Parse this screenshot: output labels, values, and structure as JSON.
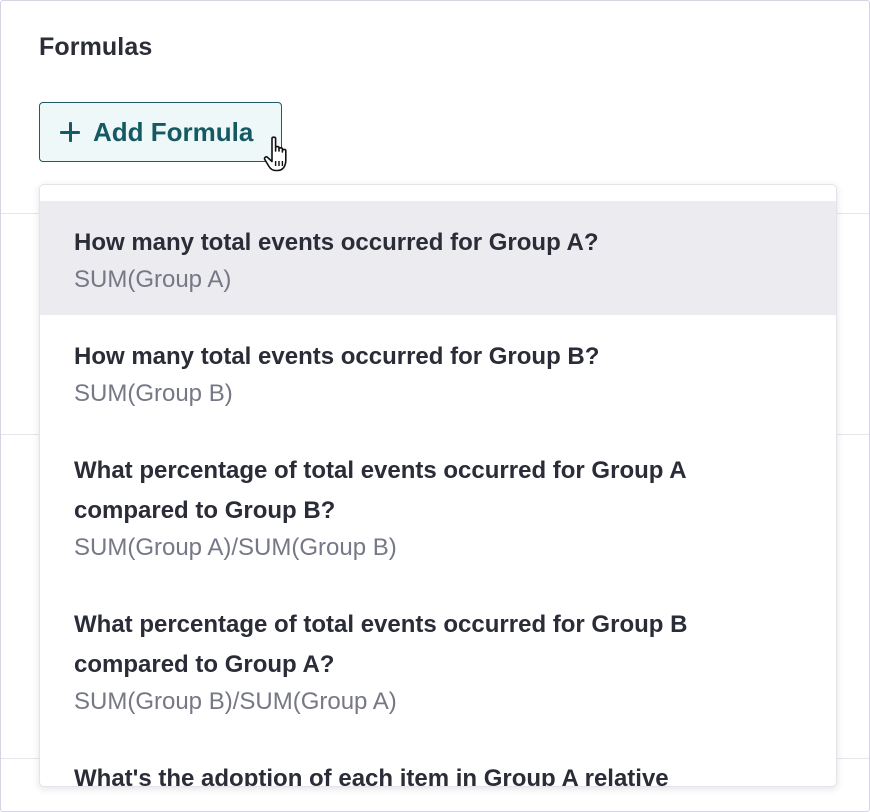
{
  "section": {
    "title": "Formulas"
  },
  "add_button": {
    "label": "Add Formula",
    "icon": "plus-icon"
  },
  "cursor": {
    "icon": "hand-pointer-icon"
  },
  "dropdown": {
    "options": [
      {
        "question": "How many total events occurred for Group A?",
        "formula": "SUM(Group A)",
        "highlighted": true
      },
      {
        "question": "How many total events occurred for Group B?",
        "formula": "SUM(Group B)",
        "highlighted": false
      },
      {
        "question": "What percentage of total events occurred for Group A compared to Group B?",
        "formula": "SUM(Group A)/SUM(Group B)",
        "highlighted": false
      },
      {
        "question": "What percentage of total events occurred for Group B compared to Group A?",
        "formula": "SUM(Group B)/SUM(Group A)",
        "highlighted": false
      },
      {
        "question": "What's the adoption of each item in Group A relative",
        "formula": "",
        "highlighted": false
      }
    ]
  },
  "colors": {
    "accent": "#155a62",
    "button_bg": "#eef8f9",
    "highlight_bg": "#ebebf0",
    "formula_text": "#767886"
  }
}
